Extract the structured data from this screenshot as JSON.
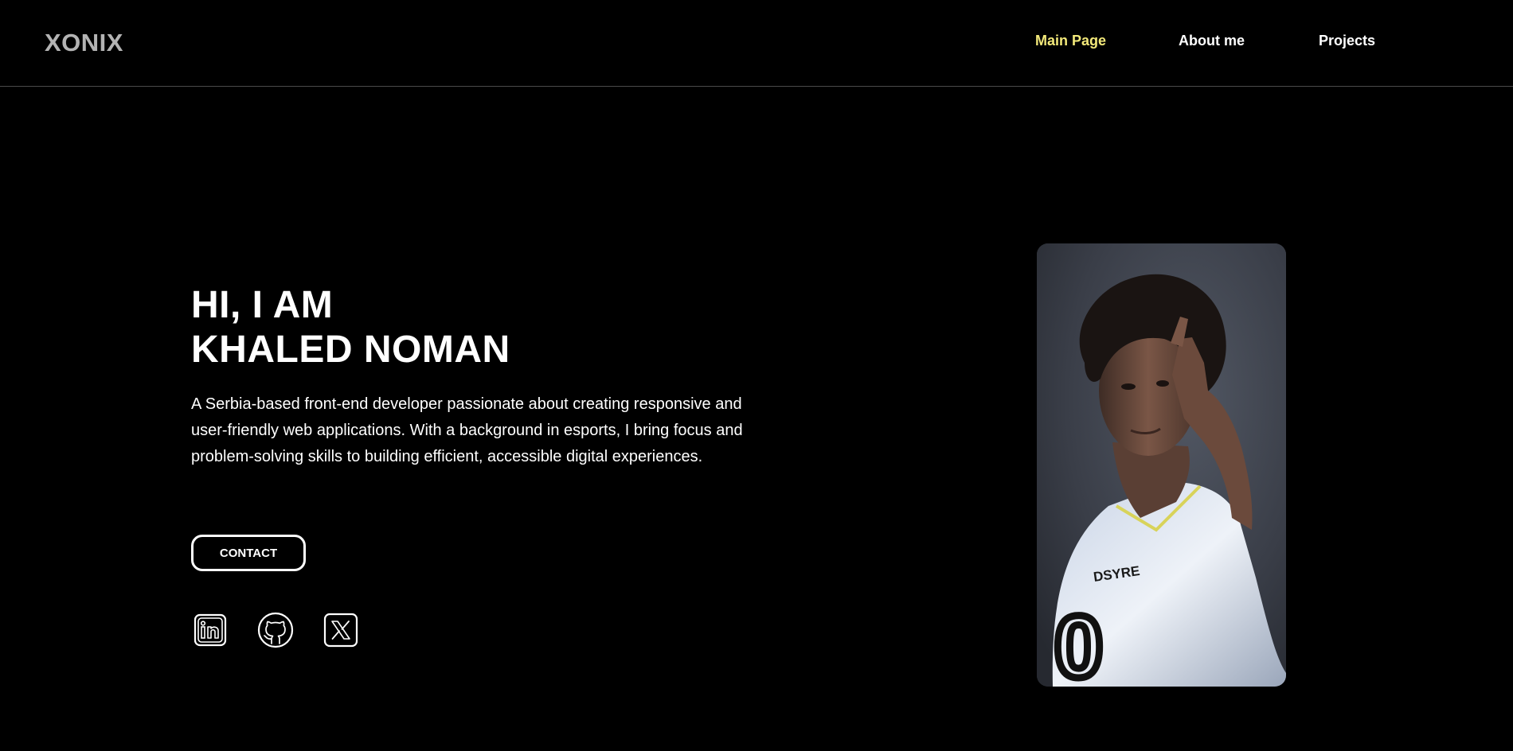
{
  "header": {
    "logo": "XONIX",
    "nav": [
      {
        "label": "Main Page",
        "active": true
      },
      {
        "label": "About me",
        "active": false
      },
      {
        "label": "Projects",
        "active": false
      }
    ]
  },
  "hero": {
    "title_line1": "HI, I AM",
    "title_line2": "KHALED NOMAN",
    "description": "A Serbia-based front-end developer passionate about creating responsive and user-friendly web applications. With a background in esports, I bring focus and problem-solving skills to building efficient, accessible digital experiences.",
    "contact_label": "CONTACT",
    "socials": [
      {
        "icon": "linkedin-icon"
      },
      {
        "icon": "github-icon"
      },
      {
        "icon": "x-twitter-icon"
      }
    ]
  },
  "photo": {
    "jersey_text": "DSYRE",
    "jersey_number": "0"
  },
  "colors": {
    "background": "#000000",
    "accent": "#f3e97a",
    "logo": "#b3b3b3",
    "text": "#ffffff"
  }
}
